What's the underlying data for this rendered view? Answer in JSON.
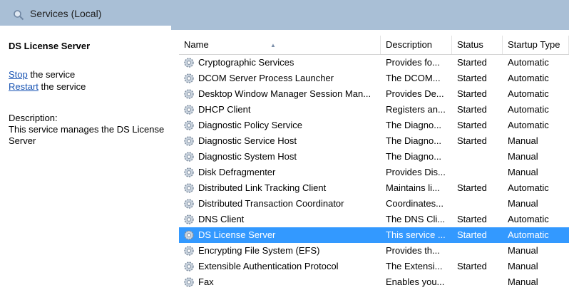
{
  "window": {
    "title": "Services (Local)",
    "icon": "magnifier-gear-icon"
  },
  "left_panel": {
    "service_name": "DS License Server",
    "stop_link": "Stop",
    "stop_suffix": " the service",
    "restart_link": "Restart",
    "restart_suffix": " the service",
    "description_label": "Description:",
    "description_text": "This service manages the DS License Server"
  },
  "table": {
    "columns": [
      "Name",
      "Description",
      "Status",
      "Startup Type"
    ],
    "sort_column": "Name",
    "rows": [
      {
        "name": "Cryptographic Services",
        "description": "Provides fo...",
        "status": "Started",
        "startup": "Automatic"
      },
      {
        "name": "DCOM Server Process Launcher",
        "description": "The DCOM...",
        "status": "Started",
        "startup": "Automatic"
      },
      {
        "name": "Desktop Window Manager Session Man...",
        "description": "Provides De...",
        "status": "Started",
        "startup": "Automatic"
      },
      {
        "name": "DHCP Client",
        "description": "Registers an...",
        "status": "Started",
        "startup": "Automatic"
      },
      {
        "name": "Diagnostic Policy Service",
        "description": "The Diagno...",
        "status": "Started",
        "startup": "Automatic"
      },
      {
        "name": "Diagnostic Service Host",
        "description": "The Diagno...",
        "status": "Started",
        "startup": "Manual"
      },
      {
        "name": "Diagnostic System Host",
        "description": "The Diagno...",
        "status": "",
        "startup": "Manual"
      },
      {
        "name": "Disk Defragmenter",
        "description": "Provides Dis...",
        "status": "",
        "startup": "Manual"
      },
      {
        "name": "Distributed Link Tracking Client",
        "description": "Maintains li...",
        "status": "Started",
        "startup": "Automatic"
      },
      {
        "name": "Distributed Transaction Coordinator",
        "description": "Coordinates...",
        "status": "",
        "startup": "Manual"
      },
      {
        "name": "DNS Client",
        "description": "The DNS Cli...",
        "status": "Started",
        "startup": "Automatic"
      },
      {
        "name": "DS License Server",
        "description": "This service ...",
        "status": "Started",
        "startup": "Automatic",
        "selected": true
      },
      {
        "name": "Encrypting File System (EFS)",
        "description": "Provides th...",
        "status": "",
        "startup": "Manual"
      },
      {
        "name": "Extensible Authentication Protocol",
        "description": "The Extensi...",
        "status": "Started",
        "startup": "Manual"
      },
      {
        "name": "Fax",
        "description": "Enables you...",
        "status": "",
        "startup": "Manual"
      }
    ]
  },
  "colors": {
    "title_bar": "#a9bfd6",
    "selection": "#3399ff",
    "link": "#1a55b4"
  },
  "row_icon": "service-gear-icon"
}
